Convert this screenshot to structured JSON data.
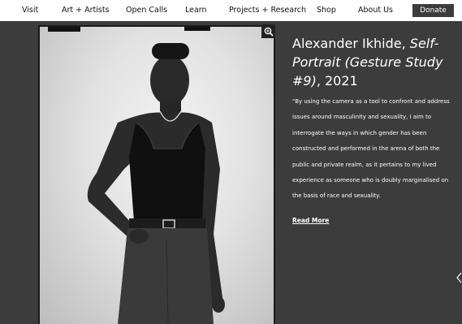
{
  "nav": {
    "items": [
      "Visit",
      "Art + Artists",
      "Open Calls",
      "Learn",
      "Projects + Research",
      "Shop",
      "About Us"
    ],
    "donate_label": "Donate"
  },
  "photo": {
    "zoom_icon": "zoom-in-icon"
  },
  "artwork": {
    "artist": "Alexander Ikhide, ",
    "title": "Self-Portrait (Gesture Study #9)",
    "year": ", 2021",
    "description": "\"By using the camera as a tool to confront and address issues around masculinity and sexuality, I aim to interrogate the ways in which gender has been constructed and performed in the arena of both the public and private realm, as it pertains to my lived experience as someone who is doubly marginalised on the basis of race and sexuality.",
    "read_more": "Read More"
  },
  "colors": {
    "background": "#3c3c3c",
    "nav_background": "#ffffff",
    "donate_background": "#3c3c3c",
    "text": "#ffffff"
  }
}
